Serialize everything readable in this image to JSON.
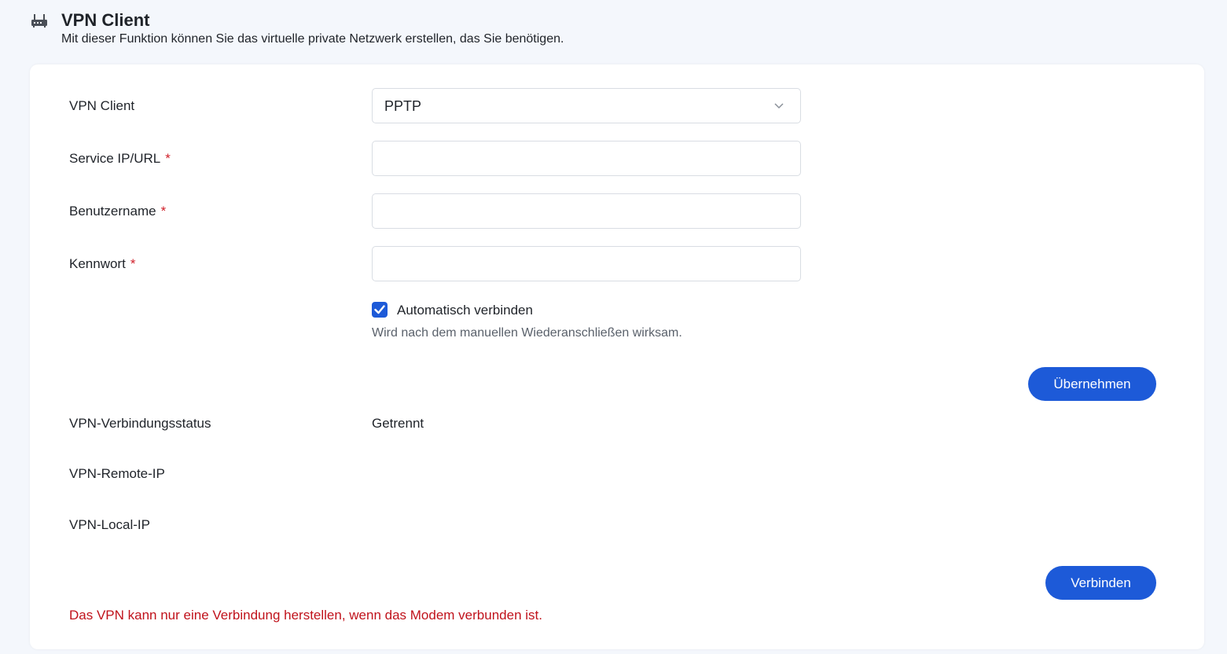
{
  "header": {
    "icon": "router-icon",
    "title": "VPN Client",
    "subtitle": "Mit dieser Funktion können Sie das virtuelle private Netzwerk erstellen, das Sie benötigen."
  },
  "form": {
    "vpn_client": {
      "label": "VPN Client",
      "value": "PPTP"
    },
    "service": {
      "label": "Service IP/URL",
      "required_mark": "*",
      "value": "",
      "placeholder": ""
    },
    "username": {
      "label": "Benutzername",
      "required_mark": "*",
      "value": "",
      "placeholder": ""
    },
    "password": {
      "label": "Kennwort",
      "required_mark": "*",
      "value": "",
      "placeholder": ""
    },
    "auto_connect": {
      "label": "Automatisch verbinden",
      "checked": true,
      "hint": "Wird nach dem manuellen Wiederanschließen wirksam."
    },
    "apply_label": "Übernehmen"
  },
  "status": {
    "connection_label": "VPN-Verbindungsstatus",
    "connection_value": "Getrennt",
    "remote_ip_label": "VPN-Remote-IP",
    "remote_ip_value": "",
    "local_ip_label": "VPN-Local-IP",
    "local_ip_value": "",
    "connect_label": "Verbinden"
  },
  "warning": "Das VPN kann nur eine Verbindung herstellen, wenn das Modem verbunden ist.",
  "colors": {
    "primary": "#1d5ad8",
    "required": "#d0202a",
    "warning": "#c0121b",
    "background": "#f4f7fc"
  }
}
